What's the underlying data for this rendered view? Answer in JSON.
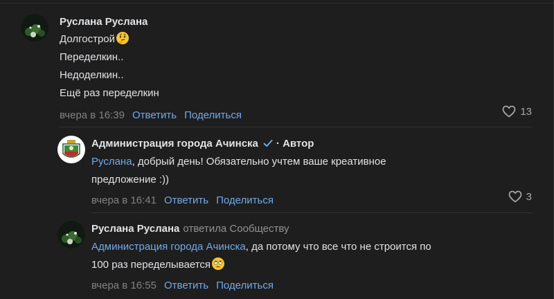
{
  "comments": [
    {
      "author": "Руслана Руслана",
      "lines": [
        "Долгострой",
        "Переделкин..",
        "Недоделкин..",
        "Ещё раз переделкин"
      ],
      "emoji": "thinking-face",
      "time": "вчера в 16:39",
      "reply_label": "Ответить",
      "share_label": "Поделиться",
      "likes": "13"
    },
    {
      "author": "Администрация города Ачинска",
      "author_role": "· Автор",
      "mention": "Руслана",
      "text_line1": ", добрый день! Обязательно учтем ваше креативное",
      "text_line2": "предложение :))",
      "time": "вчера в 16:41",
      "reply_label": "Ответить",
      "share_label": "Поделиться",
      "likes": "3"
    },
    {
      "author": "Руслана Руслана",
      "reply_note": "ответила Сообществу",
      "mention": "Администрация города Ачинска",
      "text_line1": ", да потому что все что не строится по",
      "text_line2": "100 раз переделывается",
      "emoji": "rolling-eyes-face",
      "time": "вчера в 16:55",
      "reply_label": "Ответить",
      "share_label": "Поделиться"
    }
  ],
  "colors": {
    "background": "#1e1e1e",
    "text": "#e1e3e6",
    "link": "#71aaeb",
    "meta": "#828282"
  }
}
